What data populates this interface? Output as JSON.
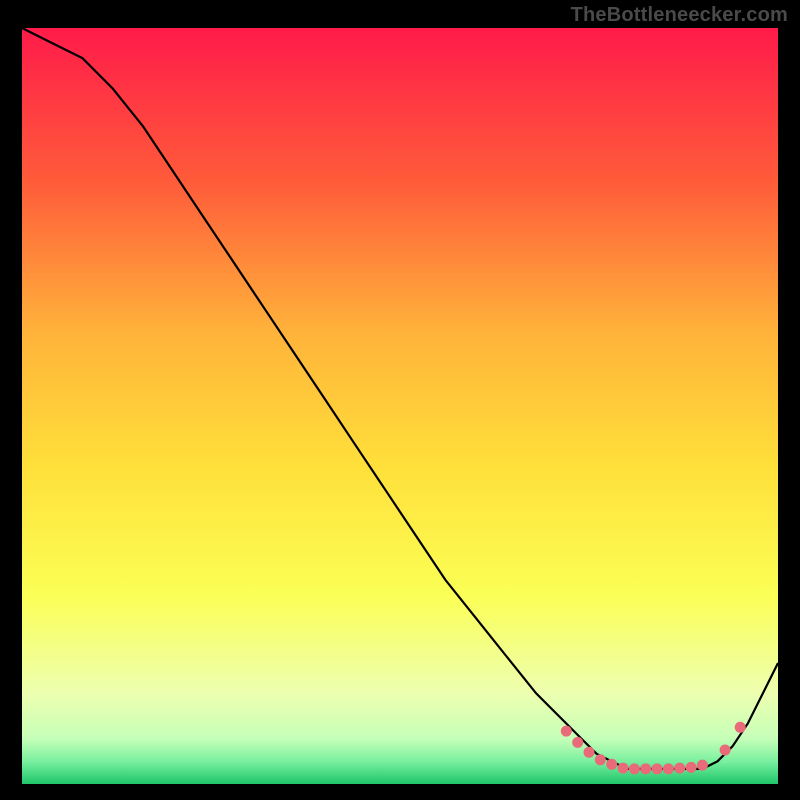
{
  "watermark": "TheBottleneecker.com",
  "colors": {
    "background": "#000000",
    "gradient_top": "#ff1b4a",
    "gradient_mid_upper": "#ff8a2a",
    "gradient_mid": "#ffe03a",
    "gradient_mid_lower": "#f6ff6a",
    "gradient_green": "#27d86b",
    "curve": "#000000",
    "marker": "#e96a78"
  },
  "chart_data": {
    "type": "line",
    "title": "",
    "xlabel": "",
    "ylabel": "",
    "xlim": [
      0,
      100
    ],
    "ylim": [
      0,
      100
    ],
    "grid": false,
    "legend": false,
    "series": [
      {
        "name": "curve",
        "x": [
          0,
          4,
          8,
          12,
          16,
          20,
          24,
          28,
          32,
          36,
          40,
          44,
          48,
          52,
          56,
          60,
          64,
          68,
          72,
          74,
          76,
          78,
          80,
          82,
          84,
          86,
          88,
          90,
          92,
          94,
          96,
          98,
          100
        ],
        "y": [
          100,
          98,
          96,
          92,
          87,
          81,
          75,
          69,
          63,
          57,
          51,
          45,
          39,
          33,
          27,
          22,
          17,
          12,
          8,
          6,
          4,
          3,
          2,
          2,
          2,
          2,
          2,
          2,
          3,
          5,
          8,
          12,
          16
        ]
      }
    ],
    "markers": {
      "name": "valley-markers",
      "x": [
        72,
        73.5,
        75,
        76.5,
        78,
        79.5,
        81,
        82.5,
        84,
        85.5,
        87,
        88.5,
        90,
        93,
        95
      ],
      "y": [
        7,
        5.5,
        4.2,
        3.2,
        2.6,
        2.1,
        2.0,
        2.0,
        2.0,
        2.0,
        2.1,
        2.2,
        2.5,
        4.5,
        7.5
      ]
    }
  }
}
